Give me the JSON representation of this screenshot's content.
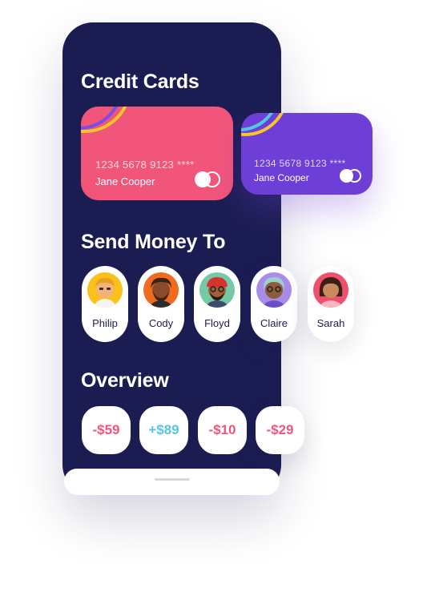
{
  "sections": {
    "cards_title": "Credit Cards",
    "send_title": "Send Money To",
    "overview_title": "Overview"
  },
  "cards": [
    {
      "number": "1234 5678 9123 ****",
      "holder": "Jane Cooper",
      "color": "#f2557a"
    },
    {
      "number": "1234 5678 9123 ****",
      "holder": "Jane Cooper",
      "color": "#6e3fd6"
    }
  ],
  "contacts": [
    {
      "name": "Philip",
      "avatar_bg": "#f9c11a"
    },
    {
      "name": "Cody",
      "avatar_bg": "#f06b1f"
    },
    {
      "name": "Floyd",
      "avatar_bg": "#76c9a6"
    },
    {
      "name": "Claire",
      "avatar_bg": "#a98be8"
    },
    {
      "name": "Sarah",
      "avatar_bg": "#f0506b"
    }
  ],
  "overview": [
    {
      "amount": "-$59",
      "color": "#f2557a"
    },
    {
      "amount": "+$89",
      "color": "#54c6e0"
    },
    {
      "amount": "-$10",
      "color": "#f2557a"
    },
    {
      "amount": "-$29",
      "color": "#f2557a"
    }
  ],
  "colors": {
    "phone_bg": "#1b1d52",
    "accent_pink": "#f2557a",
    "accent_purple": "#6e3fd6",
    "accent_cyan": "#54c6e0"
  }
}
